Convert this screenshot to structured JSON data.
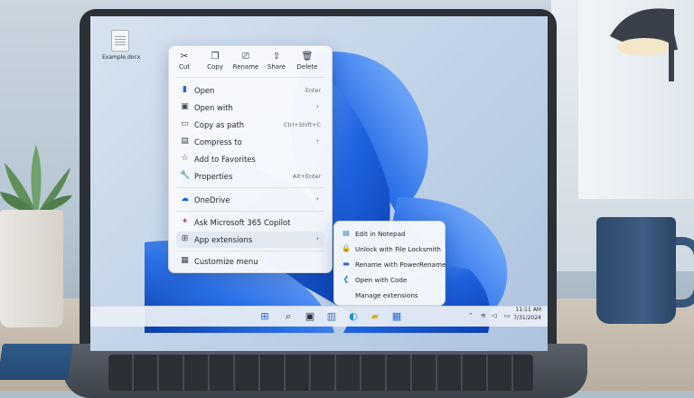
{
  "desktop": {
    "icon_label": "Example.docx"
  },
  "context_menu": {
    "quick_actions": [
      {
        "label": "Cut",
        "icon": "scissors-icon"
      },
      {
        "label": "Copy",
        "icon": "copy-icon"
      },
      {
        "label": "Rename",
        "icon": "rename-icon"
      },
      {
        "label": "Share",
        "icon": "share-icon"
      },
      {
        "label": "Delete",
        "icon": "trash-icon"
      }
    ],
    "items": [
      {
        "label": "Open",
        "shortcut": "Enter",
        "icon": "open-icon"
      },
      {
        "label": "Open with",
        "shortcut": "",
        "icon": "open-with-icon"
      },
      {
        "label": "Copy as path",
        "shortcut": "Ctrl+Shift+C",
        "icon": "path-icon"
      },
      {
        "label": "Compress to",
        "shortcut": "",
        "icon": "archive-icon"
      },
      {
        "label": "Add to Favorites",
        "shortcut": "",
        "icon": "star-icon"
      },
      {
        "label": "Properties",
        "shortcut": "Alt+Enter",
        "icon": "wrench-icon"
      },
      {
        "label": "OneDrive",
        "shortcut": "",
        "icon": "cloud-icon"
      },
      {
        "label": "Ask Microsoft 365 Copilot",
        "shortcut": "",
        "icon": "copilot-icon"
      },
      {
        "label": "App extensions",
        "shortcut": "",
        "icon": "extensions-icon"
      },
      {
        "label": "Customize menu",
        "shortcut": "",
        "icon": "customize-icon"
      }
    ]
  },
  "submenu": {
    "items": [
      {
        "label": "Edit in Notepad",
        "icon": "notepad-icon"
      },
      {
        "label": "Unlock with File Locksmith",
        "icon": "lock-icon"
      },
      {
        "label": "Rename with PowerRename",
        "icon": "powerrename-icon"
      },
      {
        "label": "Open with Code",
        "icon": "vscode-icon"
      },
      {
        "label": "Manage extensions",
        "icon": ""
      }
    ]
  },
  "taskbar": {
    "time": "11:11 AM",
    "date": "7/31/2024"
  },
  "colors": {
    "accent": "#0a5cd8",
    "menu_bg": "#f7f9fc",
    "highlight": "#e3e9f1"
  }
}
